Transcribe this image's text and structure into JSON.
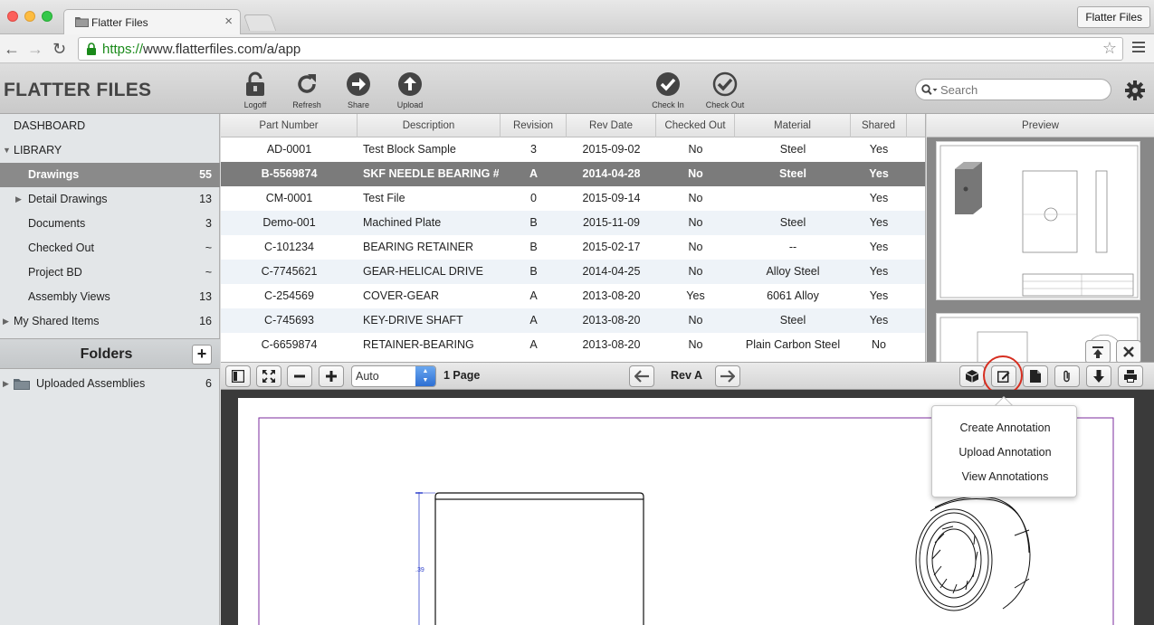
{
  "browser": {
    "tab_title": "Flatter Files",
    "tab_close": "×",
    "url_scheme": "https://",
    "url_rest": "www.flatterfiles.com/a/app",
    "profile_label": "Flatter Files",
    "back": "←",
    "forward": "→",
    "reload": "↻",
    "star": "☆"
  },
  "header": {
    "brand": "FLATTER FILES",
    "tools": {
      "logoff": "Logoff",
      "refresh": "Refresh",
      "share": "Share",
      "upload": "Upload",
      "check_in": "Check In",
      "check_out": "Check Out"
    },
    "search_placeholder": "Search"
  },
  "sidebar": {
    "items": [
      {
        "label": "DASHBOARD",
        "count": ""
      },
      {
        "label": "LIBRARY",
        "count": ""
      },
      {
        "label": "Drawings",
        "count": "55"
      },
      {
        "label": "Detail Drawings",
        "count": "13"
      },
      {
        "label": "Documents",
        "count": "3"
      },
      {
        "label": "Checked Out",
        "count": "~"
      },
      {
        "label": "Project BD",
        "count": "~"
      },
      {
        "label": "Assembly Views",
        "count": "13"
      },
      {
        "label": "My Shared Items",
        "count": "16"
      }
    ],
    "folders_title": "Folders",
    "folders_add": "+",
    "folders": [
      {
        "label": "Uploaded Assemblies",
        "count": "6"
      }
    ],
    "tri_down": "▼",
    "tri_right": "▶"
  },
  "table": {
    "headers": [
      "Part Number",
      "Description",
      "Revision",
      "Rev Date",
      "Checked Out",
      "Material",
      "Shared"
    ],
    "rows": [
      [
        "AD-0001",
        "Test Block Sample",
        "3",
        "2015-09-02",
        "No",
        "Steel",
        "Yes"
      ],
      [
        "B-5569874",
        "SKF NEEDLE BEARING #H",
        "A",
        "2014-04-28",
        "No",
        "Steel",
        "Yes"
      ],
      [
        "CM-0001",
        "Test File",
        "0",
        "2015-09-14",
        "No",
        "",
        "Yes"
      ],
      [
        "Demo-001",
        "Machined Plate",
        "B",
        "2015-11-09",
        "No",
        "Steel",
        "Yes"
      ],
      [
        "C-101234",
        "BEARING RETAINER",
        "B",
        "2015-02-17",
        "No",
        "--",
        "Yes"
      ],
      [
        "C-7745621",
        "GEAR-HELICAL DRIVE",
        "B",
        "2014-04-25",
        "No",
        "Alloy Steel",
        "Yes"
      ],
      [
        "C-254569",
        "COVER-GEAR",
        "A",
        "2013-08-20",
        "Yes",
        "6061 Alloy",
        "Yes"
      ],
      [
        "C-745693",
        "KEY-DRIVE SHAFT",
        "A",
        "2013-08-20",
        "No",
        "Steel",
        "Yes"
      ],
      [
        "C-6659874",
        "RETAINER-BEARING",
        "A",
        "2013-08-20",
        "No",
        "Plain Carbon Steel",
        "No"
      ]
    ],
    "selected_row": 1
  },
  "preview": {
    "title": "Preview"
  },
  "viewer": {
    "zoom_value": "Auto",
    "page_count": "1 Page",
    "revision": "Rev A",
    "dimension_label": ".39"
  },
  "annotation_menu": {
    "items": [
      "Create Annotation",
      "Upload Annotation",
      "View Annotations"
    ]
  },
  "colors": {
    "selected_row": "#7b7b7b",
    "highlight_ring": "#d62d1f",
    "url_scheme": "#1a8a1a"
  }
}
